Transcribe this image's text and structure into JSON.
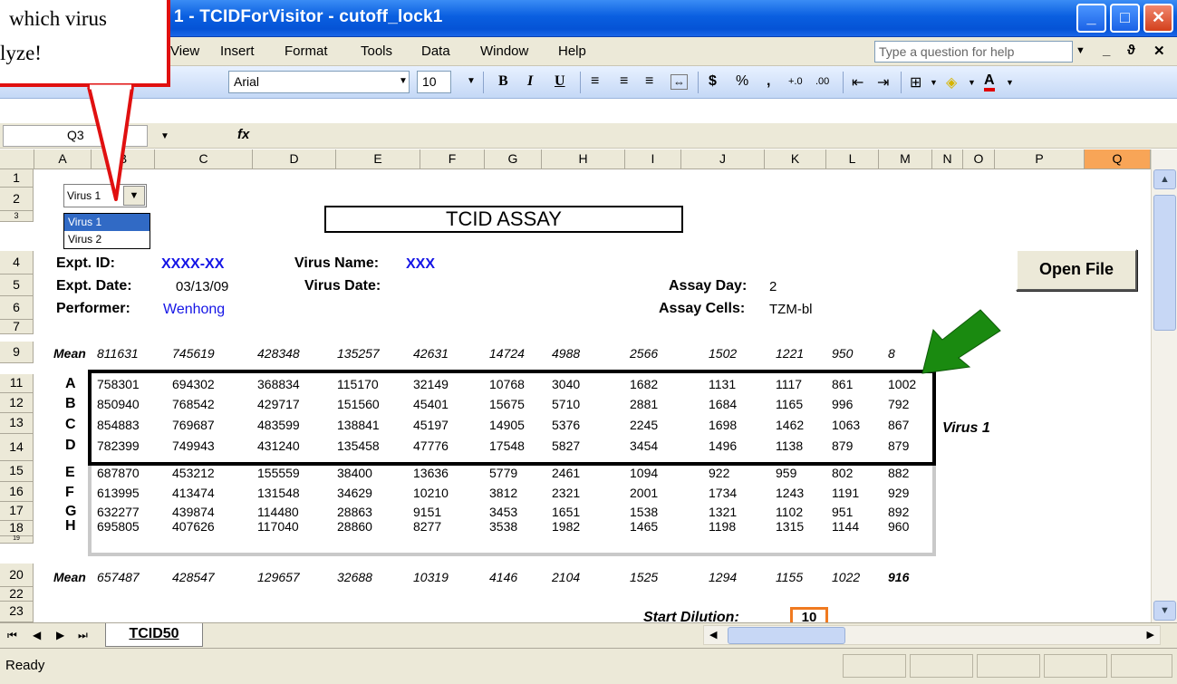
{
  "window": {
    "title": "1 - TCIDForVisitor - cutoff_lock1",
    "minimize": "_",
    "maximize": "□",
    "close": "✕"
  },
  "menu": {
    "items": [
      "View",
      "Insert",
      "Format",
      "Tools",
      "Data",
      "Window",
      "Help"
    ],
    "help_placeholder": "Type a question for help",
    "mdi": [
      "_",
      "ϑ",
      "✕"
    ]
  },
  "toolbar": {
    "font": "Arial",
    "size": "10",
    "bold": "B",
    "italic": "I",
    "underline": "U",
    "currency": "$",
    "percent": "%",
    "comma": ",",
    "inc_decimal": "+.0",
    "dec_decimal": ".00",
    "font_color": "A"
  },
  "formula_bar": {
    "name_box": "Q3",
    "fx": "fx"
  },
  "columns": [
    "A",
    "B",
    "C",
    "D",
    "E",
    "F",
    "G",
    "H",
    "I",
    "J",
    "K",
    "L",
    "M",
    "N",
    "O",
    "P",
    "Q"
  ],
  "active_column": "Q",
  "rows": [
    "1",
    "2",
    "3",
    "4",
    "5",
    "6",
    "7",
    "9",
    "11",
    "12",
    "13",
    "14",
    "15",
    "16",
    "17",
    "18",
    "19",
    "20",
    "22",
    "23"
  ],
  "sheet": {
    "title": "TCID ASSAY",
    "virus_dropdown": {
      "selected": "Virus 1",
      "options": [
        "Virus 1",
        "Virus 2"
      ]
    },
    "expt_id_label": "Expt. ID:",
    "expt_id_value": "XXXX-XX",
    "virus_name_label": "Virus Name:",
    "virus_name_value": "XXX",
    "expt_date_label": "Expt. Date:",
    "expt_date_value": "03/13/09",
    "virus_date_label": "Virus Date:",
    "assay_day_label": "Assay Day:",
    "assay_day_value": "2",
    "performer_label": "Performer:",
    "performer_value": "Wenhong",
    "assay_cells_label": "Assay Cells:",
    "assay_cells_value": "TZM-bl",
    "open_file": "Open File",
    "mean_label": "Mean",
    "mean_top": [
      "811631",
      "745619",
      "428348",
      "135257",
      "42631",
      "14724",
      "4988",
      "2566",
      "1502",
      "1221",
      "950",
      "8"
    ],
    "data_rows": [
      {
        "row": "A",
        "values": [
          "758301",
          "694302",
          "368834",
          "115170",
          "32149",
          "10768",
          "3040",
          "1682",
          "1131",
          "1117",
          "861",
          "1002"
        ]
      },
      {
        "row": "B",
        "values": [
          "850940",
          "768542",
          "429717",
          "151560",
          "45401",
          "15675",
          "5710",
          "2881",
          "1684",
          "1165",
          "996",
          "792"
        ]
      },
      {
        "row": "C",
        "values": [
          "854883",
          "769687",
          "483599",
          "138841",
          "45197",
          "14905",
          "5376",
          "2245",
          "1698",
          "1462",
          "1063",
          "867"
        ]
      },
      {
        "row": "D",
        "values": [
          "782399",
          "749943",
          "431240",
          "135458",
          "47776",
          "17548",
          "5827",
          "3454",
          "1496",
          "1138",
          "879",
          "879"
        ]
      },
      {
        "row": "E",
        "values": [
          "687870",
          "453212",
          "155559",
          "38400",
          "13636",
          "5779",
          "2461",
          "1094",
          "922",
          "959",
          "802",
          "882"
        ]
      },
      {
        "row": "F",
        "values": [
          "613995",
          "413474",
          "131548",
          "34629",
          "10210",
          "3812",
          "2321",
          "2001",
          "1734",
          "1243",
          "1191",
          "929"
        ]
      },
      {
        "row": "G",
        "values": [
          "632277",
          "439874",
          "114480",
          "28863",
          "9151",
          "3453",
          "1651",
          "1538",
          "1321",
          "1102",
          "951",
          "892"
        ]
      },
      {
        "row": "H",
        "values": [
          "695805",
          "407626",
          "117040",
          "28860",
          "8277",
          "3538",
          "1982",
          "1465",
          "1198",
          "1315",
          "1144",
          "960"
        ]
      }
    ],
    "virus1_label": "Virus 1",
    "mean_bottom": [
      "657487",
      "428547",
      "129657",
      "32688",
      "10319",
      "4146",
      "2104",
      "1525",
      "1294",
      "1155",
      "1022",
      "916"
    ],
    "start_dilution_label": "Start Dilution:",
    "start_dilution_value": "10"
  },
  "callout": {
    "line1": "which virus",
    "line2": "lyze!"
  },
  "tabs": {
    "nav": [
      "⏮",
      "◀",
      "▶",
      "⏭"
    ],
    "sheet": "TCID50"
  },
  "status": {
    "text": "Ready"
  },
  "colors": {
    "title_blue": "#0553d6",
    "callout_red": "#e01010",
    "arrow_green": "#1a8a10",
    "value_blue": "#1515e6",
    "active_col": "#f8a557",
    "start_border": "#f07a20"
  }
}
